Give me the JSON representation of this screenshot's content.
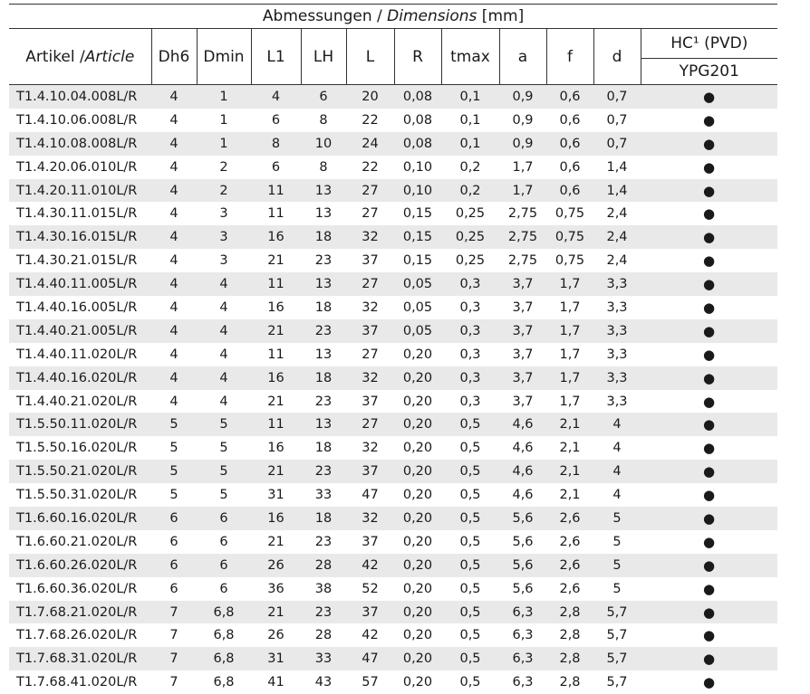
{
  "header": {
    "title_de": "Abmessungen / ",
    "title_en": "Dimensions",
    "title_unit": " [mm]",
    "article_de": "Artikel /",
    "article_en": "Article",
    "columns": [
      "Dh6",
      "Dmin",
      "L1",
      "LH",
      "L",
      "R",
      "tmax",
      "a",
      "f",
      "d"
    ],
    "hc_top": "HC¹ (PVD)",
    "hc_bottom": "YPG201"
  },
  "rows": [
    [
      "T1.4.10.04.008L/R",
      "4",
      "1",
      "4",
      "6",
      "20",
      "0,08",
      "0,1",
      "0,9",
      "0,6",
      "0,7",
      "●"
    ],
    [
      "T1.4.10.06.008L/R",
      "4",
      "1",
      "6",
      "8",
      "22",
      "0,08",
      "0,1",
      "0,9",
      "0,6",
      "0,7",
      "●"
    ],
    [
      "T1.4.10.08.008L/R",
      "4",
      "1",
      "8",
      "10",
      "24",
      "0,08",
      "0,1",
      "0,9",
      "0,6",
      "0,7",
      "●"
    ],
    [
      "T1.4.20.06.010L/R",
      "4",
      "2",
      "6",
      "8",
      "22",
      "0,10",
      "0,2",
      "1,7",
      "0,6",
      "1,4",
      "●"
    ],
    [
      "T1.4.20.11.010L/R",
      "4",
      "2",
      "11",
      "13",
      "27",
      "0,10",
      "0,2",
      "1,7",
      "0,6",
      "1,4",
      "●"
    ],
    [
      "T1.4.30.11.015L/R",
      "4",
      "3",
      "11",
      "13",
      "27",
      "0,15",
      "0,25",
      "2,75",
      "0,75",
      "2,4",
      "●"
    ],
    [
      "T1.4.30.16.015L/R",
      "4",
      "3",
      "16",
      "18",
      "32",
      "0,15",
      "0,25",
      "2,75",
      "0,75",
      "2,4",
      "●"
    ],
    [
      "T1.4.30.21.015L/R",
      "4",
      "3",
      "21",
      "23",
      "37",
      "0,15",
      "0,25",
      "2,75",
      "0,75",
      "2,4",
      "●"
    ],
    [
      "T1.4.40.11.005L/R",
      "4",
      "4",
      "11",
      "13",
      "27",
      "0,05",
      "0,3",
      "3,7",
      "1,7",
      "3,3",
      "●"
    ],
    [
      "T1.4.40.16.005L/R",
      "4",
      "4",
      "16",
      "18",
      "32",
      "0,05",
      "0,3",
      "3,7",
      "1,7",
      "3,3",
      "●"
    ],
    [
      "T1.4.40.21.005L/R",
      "4",
      "4",
      "21",
      "23",
      "37",
      "0,05",
      "0,3",
      "3,7",
      "1,7",
      "3,3",
      "●"
    ],
    [
      "T1.4.40.11.020L/R",
      "4",
      "4",
      "11",
      "13",
      "27",
      "0,20",
      "0,3",
      "3,7",
      "1,7",
      "3,3",
      "●"
    ],
    [
      "T1.4.40.16.020L/R",
      "4",
      "4",
      "16",
      "18",
      "32",
      "0,20",
      "0,3",
      "3,7",
      "1,7",
      "3,3",
      "●"
    ],
    [
      "T1.4.40.21.020L/R",
      "4",
      "4",
      "21",
      "23",
      "37",
      "0,20",
      "0,3",
      "3,7",
      "1,7",
      "3,3",
      "●"
    ],
    [
      "T1.5.50.11.020L/R",
      "5",
      "5",
      "11",
      "13",
      "27",
      "0,20",
      "0,5",
      "4,6",
      "2,1",
      "4",
      "●"
    ],
    [
      "T1.5.50.16.020L/R",
      "5",
      "5",
      "16",
      "18",
      "32",
      "0,20",
      "0,5",
      "4,6",
      "2,1",
      "4",
      "●"
    ],
    [
      "T1.5.50.21.020L/R",
      "5",
      "5",
      "21",
      "23",
      "37",
      "0,20",
      "0,5",
      "4,6",
      "2,1",
      "4",
      "●"
    ],
    [
      "T1.5.50.31.020L/R",
      "5",
      "5",
      "31",
      "33",
      "47",
      "0,20",
      "0,5",
      "4,6",
      "2,1",
      "4",
      "●"
    ],
    [
      "T1.6.60.16.020L/R",
      "6",
      "6",
      "16",
      "18",
      "32",
      "0,20",
      "0,5",
      "5,6",
      "2,6",
      "5",
      "●"
    ],
    [
      "T1.6.60.21.020L/R",
      "6",
      "6",
      "21",
      "23",
      "37",
      "0,20",
      "0,5",
      "5,6",
      "2,6",
      "5",
      "●"
    ],
    [
      "T1.6.60.26.020L/R",
      "6",
      "6",
      "26",
      "28",
      "42",
      "0,20",
      "0,5",
      "5,6",
      "2,6",
      "5",
      "●"
    ],
    [
      "T1.6.60.36.020L/R",
      "6",
      "6",
      "36",
      "38",
      "52",
      "0,20",
      "0,5",
      "5,6",
      "2,6",
      "5",
      "●"
    ],
    [
      "T1.7.68.21.020L/R",
      "7",
      "6,8",
      "21",
      "23",
      "37",
      "0,20",
      "0,5",
      "6,3",
      "2,8",
      "5,7",
      "●"
    ],
    [
      "T1.7.68.26.020L/R",
      "7",
      "6,8",
      "26",
      "28",
      "42",
      "0,20",
      "0,5",
      "6,3",
      "2,8",
      "5,7",
      "●"
    ],
    [
      "T1.7.68.31.020L/R",
      "7",
      "6,8",
      "31",
      "33",
      "47",
      "0,20",
      "0,5",
      "6,3",
      "2,8",
      "5,7",
      "●"
    ],
    [
      "T1.7.68.41.020L/R",
      "7",
      "6,8",
      "41",
      "43",
      "57",
      "0,20",
      "0,5",
      "6,3",
      "2,8",
      "5,7",
      "●"
    ]
  ]
}
